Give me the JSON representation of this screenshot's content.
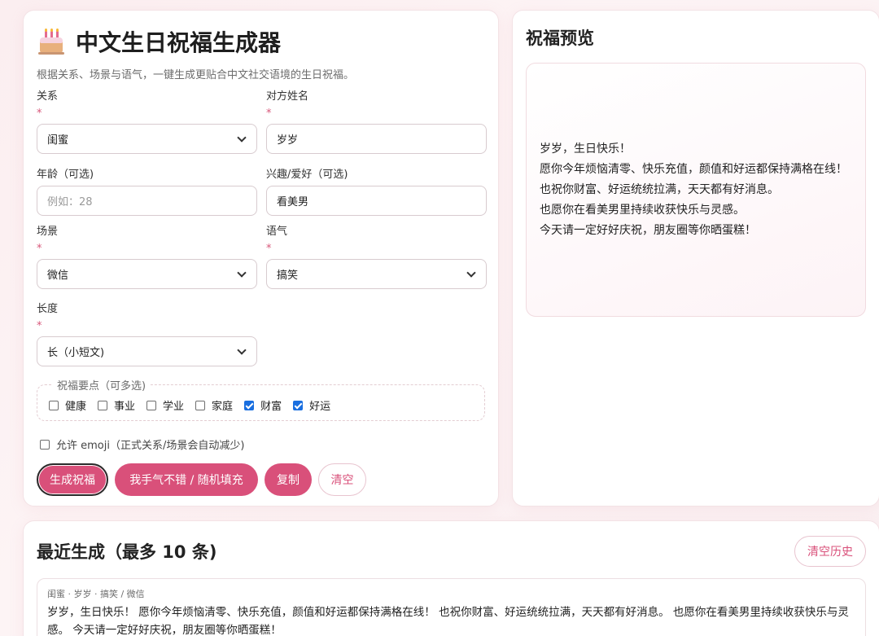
{
  "form": {
    "title": "中文生日祝福生成器",
    "subtitle": "根据关系、场景与语气，一键生成更贴合中文社交语境的生日祝福。",
    "required_mark": "*",
    "relation": {
      "label": "关系",
      "value": "闺蜜"
    },
    "name": {
      "label": "对方姓名",
      "value": "岁岁"
    },
    "age": {
      "label": "年龄（可选)",
      "placeholder": "例如：28"
    },
    "hobby": {
      "label": "兴趣/爱好（可选)",
      "value": "看美男"
    },
    "scene": {
      "label": "场景",
      "value": "微信"
    },
    "tone": {
      "label": "语气",
      "value": "搞笑"
    },
    "length": {
      "label": "长度",
      "value": "长（小短文)"
    },
    "points": {
      "legend": "祝福要点（可多选)",
      "items": [
        {
          "label": "健康",
          "checked": false
        },
        {
          "label": "事业",
          "checked": false
        },
        {
          "label": "学业",
          "checked": false
        },
        {
          "label": "家庭",
          "checked": false
        },
        {
          "label": "财富",
          "checked": true
        },
        {
          "label": "好运",
          "checked": true
        }
      ]
    },
    "emoji_label": "允许 emoji（正式关系/场景会自动减少)",
    "buttons": {
      "generate": "生成祝福",
      "random": "我手气不错 / 随机填充",
      "copy": "复制",
      "clear": "清空"
    }
  },
  "preview": {
    "title": "祝福预览",
    "lines": [
      "岁岁，生日快乐！",
      "愿你今年烦恼清零、快乐充值，颜值和好运都保持满格在线！",
      "也祝你财富、好运统统拉满，天天都有好消息。",
      "也愿你在看美男里持续收获快乐与灵感。",
      "今天请一定好好庆祝，朋友圈等你晒蛋糕！"
    ]
  },
  "history": {
    "title": "最近生成（最多 10 条)",
    "clear_button": "清空历史",
    "items": [
      {
        "meta": "闺蜜 · 岁岁 · 搞笑 / 微信",
        "text": "岁岁，生日快乐！ 愿你今年烦恼清零、快乐充值，颜值和好运都保持满格在线！ 也祝你财富、好运统统拉满，天天都有好消息。 也愿你在看美男里持续收获快乐与灵感。 今天请一定好好庆祝，朋友圈等你晒蛋糕！"
      }
    ]
  },
  "colors": {
    "accent": "#d9507a",
    "background": "#fbeef0"
  },
  "icons": {
    "title_icon": "birthday-cake-icon"
  }
}
